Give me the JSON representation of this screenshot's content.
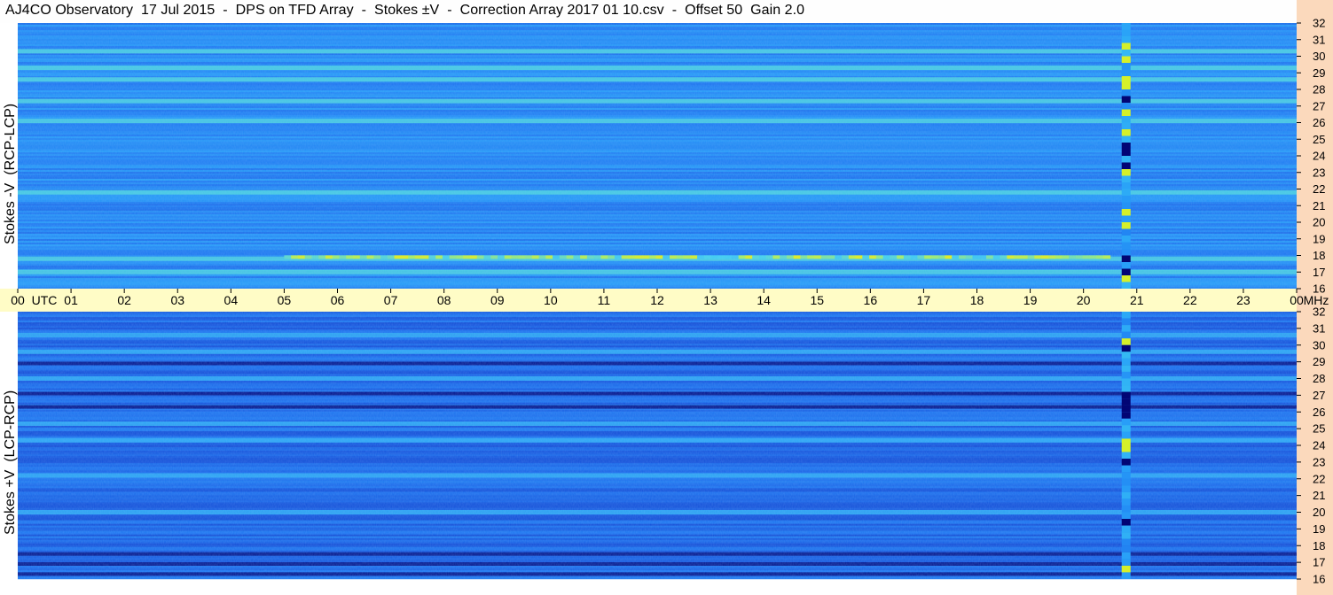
{
  "title": "AJ4CO Observatory  17 Jul 2015  -  DPS on TFD Array  -  Stokes ±V  -  Correction Array 2017 01 10.csv  -  Offset 50  Gain 2.0",
  "colors": {
    "time_axis_bg": "#fffcc6",
    "freq_axis_bg": "#fbd9bc",
    "colormap": [
      "#00006a",
      "#0a1ea8",
      "#1550d8",
      "#1f78f0",
      "#28a0f8",
      "#40d0f0",
      "#a8f060",
      "#f8f000",
      "#f86010"
    ]
  },
  "chart_data": [
    {
      "type": "heatmap",
      "ylabel": "Stokes -V  (RCP-LCP)",
      "y_ticks": [
        "16",
        "17",
        "18",
        "19",
        "20",
        "21",
        "22",
        "23",
        "24",
        "25",
        "26",
        "27",
        "28",
        "29",
        "30",
        "31",
        "32"
      ],
      "y_unit": "MHz",
      "ylim": [
        16,
        32
      ],
      "xlim": [
        "00",
        "00"
      ],
      "base_level": 0.42,
      "bright_bands_mhz": [
        17.0,
        17.8,
        21.8,
        26.1,
        27.3,
        28.6,
        29.3,
        30.3
      ],
      "bright_band_hours": [
        [
          3,
          21
        ]
      ],
      "strong_feature": {
        "freq_mhz": 17.9,
        "hours": [
          5,
          20.5
        ],
        "intensity": 0.85
      },
      "vertical_stripe_hour": 20.8
    },
    {
      "type": "heatmap",
      "ylabel": "Stokes +V  (LCP-RCP)",
      "y_ticks": [
        "16",
        "17",
        "18",
        "19",
        "20",
        "21",
        "22",
        "23",
        "24",
        "25",
        "26",
        "27",
        "28",
        "29",
        "30",
        "31",
        "32"
      ],
      "y_unit": "MHz",
      "ylim": [
        16,
        32
      ],
      "xlim": [
        "00",
        "00"
      ],
      "base_level": 0.32,
      "bright_bands_mhz": [
        20.0,
        22.2,
        24.3,
        25.3,
        28.0,
        29.6,
        30.6
      ],
      "dark_bands_mhz": [
        16.3,
        16.9,
        17.5,
        27.1,
        28.9,
        26.3
      ],
      "vertical_stripe_hour": 20.8
    }
  ],
  "time_axis": {
    "labels": [
      "00",
      "UTC",
      "01",
      "02",
      "03",
      "04",
      "05",
      "06",
      "07",
      "08",
      "09",
      "10",
      "11",
      "12",
      "13",
      "14",
      "15",
      "16",
      "17",
      "18",
      "19",
      "20",
      "21",
      "22",
      "23",
      "00",
      "MHz"
    ]
  }
}
